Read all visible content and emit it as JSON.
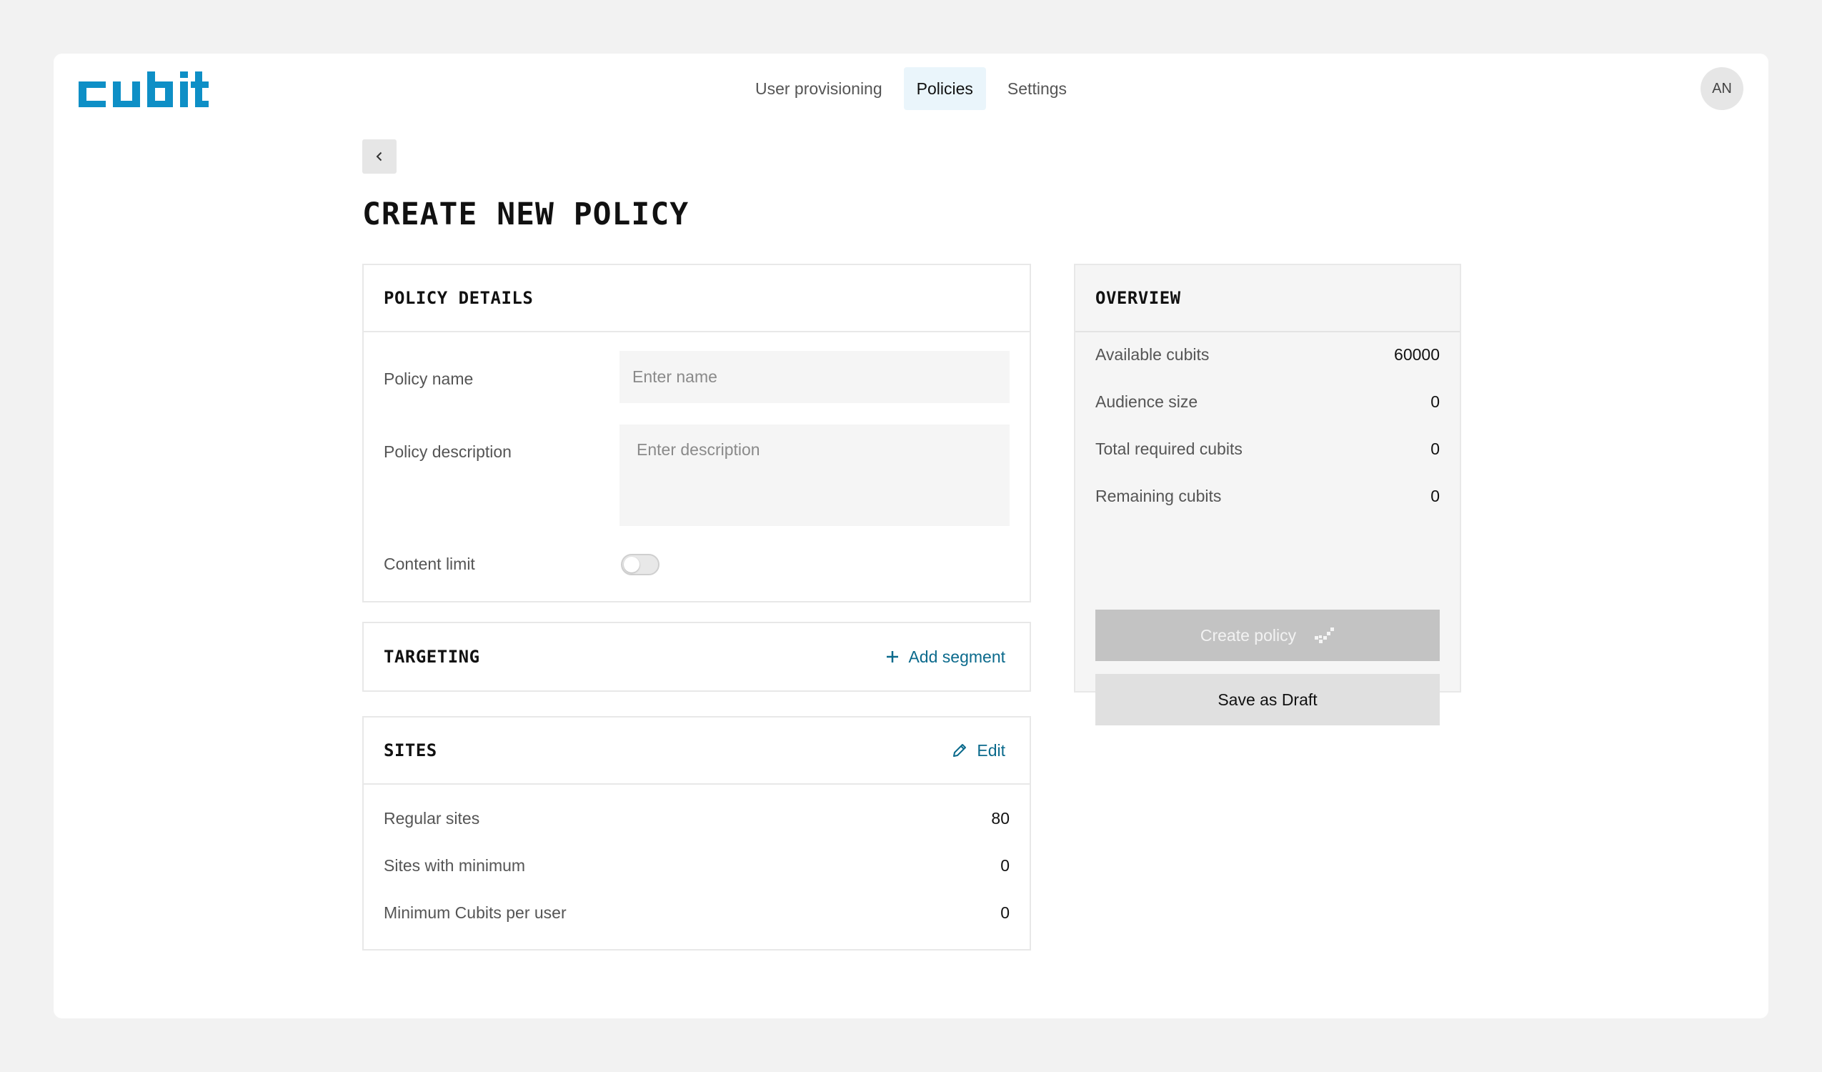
{
  "brand": {
    "logo_text": "cubit",
    "accent_color": "#0e8fc6"
  },
  "nav": {
    "items": [
      {
        "label": "User provisioning",
        "active": false
      },
      {
        "label": "Policies",
        "active": true
      },
      {
        "label": "Settings",
        "active": false
      }
    ]
  },
  "user": {
    "initials": "AN"
  },
  "page": {
    "back_icon": "chevron-left-icon",
    "title": "CREATE NEW POLICY"
  },
  "policy_details": {
    "title": "POLICY DETAILS",
    "name_label": "Policy name",
    "name_value": "",
    "name_placeholder": "Enter name",
    "description_label": "Policy description",
    "description_value": "",
    "description_placeholder": "Enter description",
    "content_limit_label": "Content limit",
    "content_limit_on": false
  },
  "targeting": {
    "title": "TARGETING",
    "add_label": "Add segment",
    "add_icon": "plus-icon"
  },
  "sites": {
    "title": "SITES",
    "edit_label": "Edit",
    "edit_icon": "pencil-icon",
    "rows": [
      {
        "label": "Regular sites",
        "value": "80"
      },
      {
        "label": "Sites with minimum",
        "value": "0"
      },
      {
        "label": "Minimum Cubits per user",
        "value": "0"
      }
    ]
  },
  "overview": {
    "title": "OVERVIEW",
    "rows": [
      {
        "label": "Available cubits",
        "value": "60000"
      },
      {
        "label": "Audience size",
        "value": "0"
      },
      {
        "label": "Total required cubits",
        "value": "0"
      },
      {
        "label": "Remaining cubits",
        "value": "0"
      }
    ],
    "create_label": "Create policy",
    "create_icon": "cubit-check-icon",
    "create_disabled": true,
    "draft_label": "Save as Draft"
  }
}
